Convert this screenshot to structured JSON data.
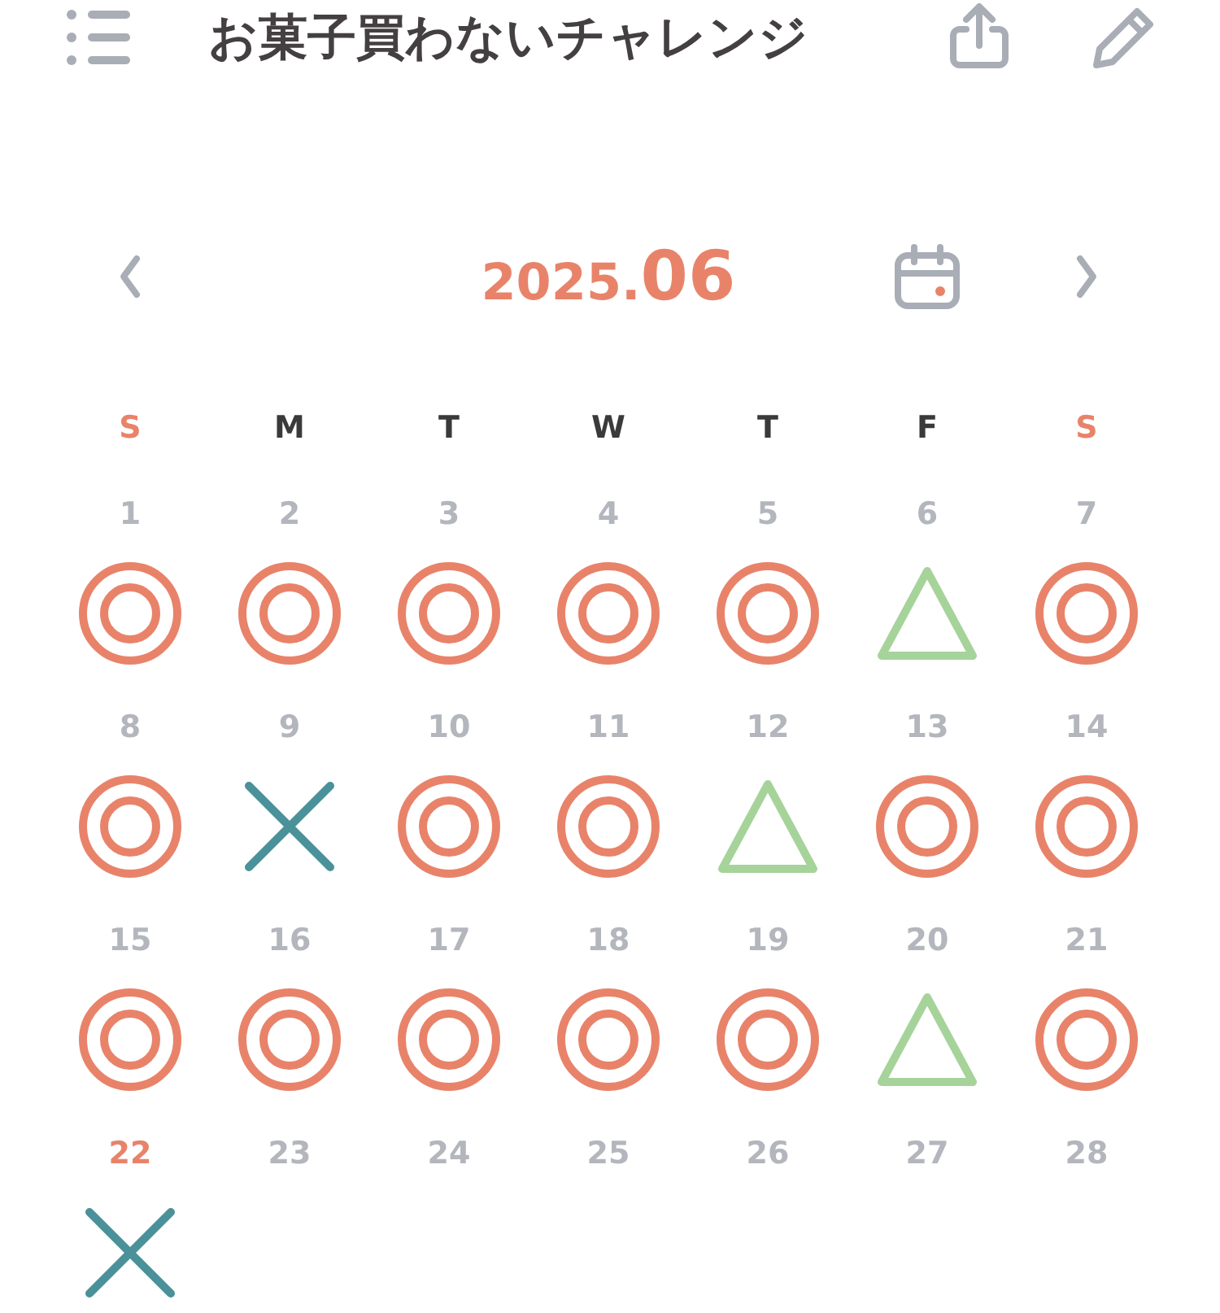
{
  "header": {
    "title": "お菓子買わないチャレンジ"
  },
  "month_nav": {
    "year": "2025.",
    "month": "06"
  },
  "weekdays": [
    {
      "label": "S",
      "weekend": true
    },
    {
      "label": "M",
      "weekend": false
    },
    {
      "label": "T",
      "weekend": false
    },
    {
      "label": "W",
      "weekend": false
    },
    {
      "label": "T",
      "weekend": false
    },
    {
      "label": "F",
      "weekend": false
    },
    {
      "label": "S",
      "weekend": true
    }
  ],
  "days": [
    {
      "day": "1",
      "today": false,
      "kind": "double_circle"
    },
    {
      "day": "2",
      "today": false,
      "kind": "double_circle"
    },
    {
      "day": "3",
      "today": false,
      "kind": "double_circle"
    },
    {
      "day": "4",
      "today": false,
      "kind": "double_circle"
    },
    {
      "day": "5",
      "today": false,
      "kind": "double_circle"
    },
    {
      "day": "6",
      "today": false,
      "kind": "triangle"
    },
    {
      "day": "7",
      "today": false,
      "kind": "double_circle"
    },
    {
      "day": "8",
      "today": false,
      "kind": "double_circle"
    },
    {
      "day": "9",
      "today": false,
      "kind": "cross"
    },
    {
      "day": "10",
      "today": false,
      "kind": "double_circle"
    },
    {
      "day": "11",
      "today": false,
      "kind": "double_circle"
    },
    {
      "day": "12",
      "today": false,
      "kind": "triangle"
    },
    {
      "day": "13",
      "today": false,
      "kind": "double_circle"
    },
    {
      "day": "14",
      "today": false,
      "kind": "double_circle"
    },
    {
      "day": "15",
      "today": false,
      "kind": "double_circle"
    },
    {
      "day": "16",
      "today": false,
      "kind": "double_circle"
    },
    {
      "day": "17",
      "today": false,
      "kind": "double_circle"
    },
    {
      "day": "18",
      "today": false,
      "kind": "double_circle"
    },
    {
      "day": "19",
      "today": false,
      "kind": "double_circle"
    },
    {
      "day": "20",
      "today": false,
      "kind": "triangle"
    },
    {
      "day": "21",
      "today": false,
      "kind": "double_circle"
    },
    {
      "day": "22",
      "today": true,
      "kind": "cross"
    },
    {
      "day": "23",
      "today": false,
      "kind": "blank"
    },
    {
      "day": "24",
      "today": false,
      "kind": "blank"
    },
    {
      "day": "25",
      "today": false,
      "kind": "blank"
    },
    {
      "day": "26",
      "today": false,
      "kind": "blank"
    },
    {
      "day": "27",
      "today": false,
      "kind": "blank"
    },
    {
      "day": "28",
      "today": false,
      "kind": "blank"
    }
  ]
}
